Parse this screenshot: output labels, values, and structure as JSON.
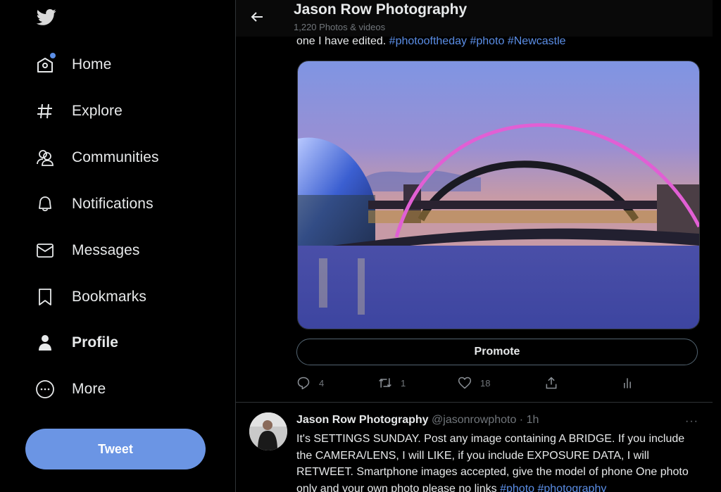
{
  "sidebar": {
    "logo": "twitter-bird-icon",
    "items": [
      {
        "label": "Home",
        "icon": "home-icon",
        "has_notification_dot": true
      },
      {
        "label": "Explore",
        "icon": "hashtag-icon"
      },
      {
        "label": "Communities",
        "icon": "communities-icon"
      },
      {
        "label": "Notifications",
        "icon": "bell-icon"
      },
      {
        "label": "Messages",
        "icon": "envelope-icon"
      },
      {
        "label": "Bookmarks",
        "icon": "bookmark-icon"
      },
      {
        "label": "Profile",
        "icon": "person-icon",
        "active": true
      },
      {
        "label": "More",
        "icon": "more-circle-icon"
      }
    ],
    "tweet_button": "Tweet"
  },
  "header": {
    "title": "Jason Row Photography",
    "subtitle": "1,220 Photos & videos"
  },
  "tweet1": {
    "text_tail": "one I have edited.",
    "hashtags": [
      "#photooftheday",
      "#photo",
      "#Newcastle"
    ],
    "image_alt": "Millennium Bridge and Tyne Bridge at dusk, Newcastle",
    "promote_label": "Promote",
    "replies": "4",
    "retweets": "1",
    "likes": "18"
  },
  "tweet2": {
    "name": "Jason Row Photography",
    "handle": "@jasonrowphoto",
    "separator": "·",
    "time": "1h",
    "more": "···",
    "text": "It's SETTINGS SUNDAY. Post any image containing A BRIDGE. If you include the CAMERA/LENS, I will LIKE, if you include EXPOSURE DATA, I will RETWEET. Smartphone images accepted, give the model of phone One photo only and your own photo please no links",
    "hashtags": [
      "#photo",
      "#photography"
    ]
  },
  "colors": {
    "accent": "#6b95e4",
    "link": "#5b8ee6",
    "background": "#000000",
    "muted": "#71767b",
    "border": "#2f3336",
    "bridge_arch": "#e15fd4"
  }
}
